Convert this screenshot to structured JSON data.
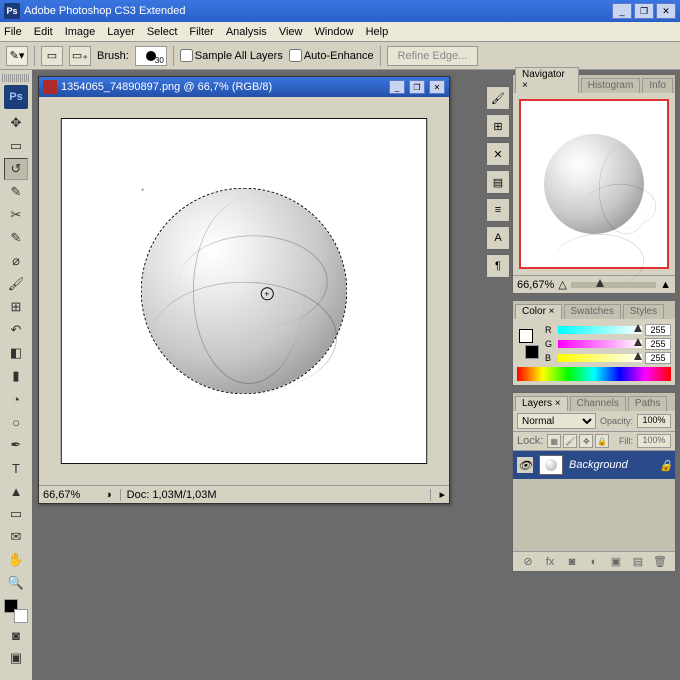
{
  "app": {
    "title": "Adobe Photoshop CS3 Extended",
    "badge": "Ps"
  },
  "menu": [
    "File",
    "Edit",
    "Image",
    "Layer",
    "Select",
    "Filter",
    "Analysis",
    "View",
    "Window",
    "Help"
  ],
  "options": {
    "brush_label": "Brush:",
    "brush_size": "30",
    "sample_all": "Sample All Layers",
    "auto_enhance": "Auto-Enhance",
    "refine": "Refine Edge..."
  },
  "doc": {
    "title": "1354065_74890897.png @ 66,7% (RGB/8)",
    "zoom": "66,67%",
    "info": "Doc: 1,03M/1,03M"
  },
  "navigator": {
    "tabs": [
      "Navigator ×",
      "Histogram",
      "Info"
    ],
    "zoom": "66,67%"
  },
  "color": {
    "tabs": [
      "Color ×",
      "Swatches",
      "Styles"
    ],
    "r_label": "R",
    "g_label": "G",
    "b_label": "B",
    "r": "255",
    "g": "255",
    "b": "255"
  },
  "layers": {
    "tabs": [
      "Layers ×",
      "Channels",
      "Paths"
    ],
    "blend": "Normal",
    "opacity_label": "Opacity:",
    "opacity": "100%",
    "lock_label": "Lock:",
    "fill_label": "Fill:",
    "fill": "100%",
    "bg_name": "Background"
  }
}
